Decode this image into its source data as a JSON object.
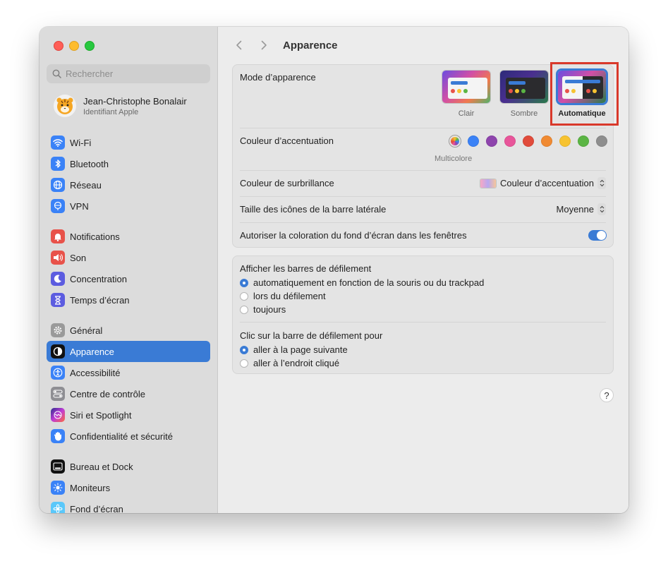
{
  "window": {
    "traffic_lights": [
      "close",
      "minimize",
      "zoom"
    ]
  },
  "sidebar": {
    "search_placeholder": "Rechercher",
    "profile": {
      "name": "Jean-Christophe Bonalair",
      "subtitle": "Identifiant Apple"
    },
    "items": [
      {
        "label": "Wi-Fi",
        "icon": "wifi-icon",
        "color": "#3a82f7"
      },
      {
        "label": "Bluetooth",
        "icon": "bluetooth-icon",
        "color": "#3a82f7"
      },
      {
        "label": "Réseau",
        "icon": "globe-icon",
        "color": "#3a82f7"
      },
      {
        "label": "VPN",
        "icon": "vpn-globe-icon",
        "color": "#3a82f7"
      },
      {
        "label": "Notifications",
        "icon": "bell-icon",
        "color": "#e8524a"
      },
      {
        "label": "Son",
        "icon": "speaker-icon",
        "color": "#e8524a"
      },
      {
        "label": "Concentration",
        "icon": "moon-icon",
        "color": "#5c5ce0"
      },
      {
        "label": "Temps d’écran",
        "icon": "hourglass-icon",
        "color": "#5c5ce0"
      },
      {
        "label": "Général",
        "icon": "gear-icon",
        "color": "#9a9a9a"
      },
      {
        "label": "Apparence",
        "icon": "appearance-icon",
        "color": "#111111"
      },
      {
        "label": "Accessibilité",
        "icon": "accessibility-icon",
        "color": "#3a82f7"
      },
      {
        "label": "Centre de contrôle",
        "icon": "control-center-icon",
        "color": "#8e8e93"
      },
      {
        "label": "Siri et Spotlight",
        "icon": "siri-icon",
        "color": "#b14ad8"
      },
      {
        "label": "Confidentialité et sécurité",
        "icon": "hand-icon",
        "color": "#3a82f7"
      },
      {
        "label": "Bureau et Dock",
        "icon": "dock-icon",
        "color": "#111111"
      },
      {
        "label": "Moniteurs",
        "icon": "sun-icon",
        "color": "#3a82f7"
      },
      {
        "label": "Fond d’écran",
        "icon": "wallpaper-icon",
        "color": "#5ac8fa"
      }
    ],
    "active_item": "Apparence"
  },
  "main": {
    "title": "Apparence",
    "appearance_mode": {
      "label": "Mode d’apparence",
      "options": [
        "Clair",
        "Sombre",
        "Automatique"
      ],
      "selected": "Automatique"
    },
    "accent_color": {
      "label": "Couleur d’accentuation",
      "selected_label": "Multicolore",
      "colors": [
        "multicolor",
        "#3b82f6",
        "#8e44ad",
        "#e8559a",
        "#e14b3b",
        "#f08a32",
        "#f7c331",
        "#5bb544",
        "#8e8e8e"
      ]
    },
    "highlight_color": {
      "label": "Couleur de surbrillance",
      "value": "Couleur d’accentuation"
    },
    "sidebar_icon_size": {
      "label": "Taille des icônes de la barre latérale",
      "value": "Moyenne"
    },
    "wallpaper_tinting": {
      "label": "Autoriser la coloration du fond d’écran dans les fenêtres",
      "enabled": true
    },
    "show_scroll_bars": {
      "label": "Afficher les barres de défilement",
      "options": [
        "automatiquement en fonction de la souris ou du trackpad",
        "lors du défilement",
        "toujours"
      ],
      "selected_index": 0
    },
    "click_scroll_bar": {
      "label": "Clic sur la barre de défilement pour",
      "options": [
        "aller à la page suivante",
        "aller à l’endroit cliqué"
      ],
      "selected_index": 0
    },
    "help": "?"
  }
}
